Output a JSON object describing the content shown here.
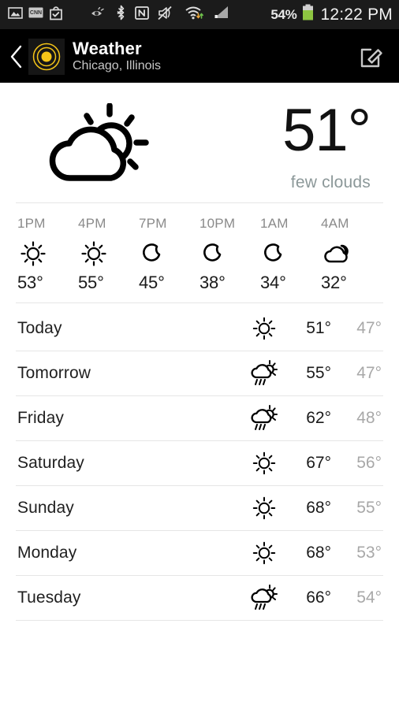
{
  "status_bar": {
    "icons": [
      {
        "name": "gallery-icon"
      },
      {
        "name": "cnn-news-icon",
        "label": "CNN"
      },
      {
        "name": "play-store-icon"
      },
      {
        "name": "smart-stay-eye-icon"
      },
      {
        "name": "bluetooth-icon"
      },
      {
        "name": "nfc-icon",
        "label": "N"
      },
      {
        "name": "sound-mute-icon"
      },
      {
        "name": "wifi-icon"
      },
      {
        "name": "cellular-signal-icon"
      }
    ],
    "battery_percent": "54%",
    "battery_color": "#8ec641",
    "clock": "12:22 PM"
  },
  "app_bar": {
    "back_icon": "back-chevron-icon",
    "app_icon": "weather-target-icon",
    "app_icon_color": "#f5c518",
    "title": "Weather",
    "subtitle": "Chicago, Illinois",
    "edit_icon": "edit-compose-icon"
  },
  "current": {
    "condition_icon": "partly-cloudy-day-icon",
    "temperature": "51°",
    "description": "few clouds"
  },
  "hourly": {
    "items": [
      {
        "time": "1PM",
        "icon": "sun-icon",
        "temp": "53°"
      },
      {
        "time": "4PM",
        "icon": "sun-icon",
        "temp": "55°"
      },
      {
        "time": "7PM",
        "icon": "moon-icon",
        "temp": "45°"
      },
      {
        "time": "10PM",
        "icon": "moon-icon",
        "temp": "38°"
      },
      {
        "time": "1AM",
        "icon": "moon-icon",
        "temp": "34°"
      },
      {
        "time": "4AM",
        "icon": "cloud-night-icon",
        "temp": "32°"
      }
    ]
  },
  "daily": {
    "items": [
      {
        "day": "Today",
        "icon": "sun-icon",
        "high": "51°",
        "low": "47°"
      },
      {
        "day": "Tomorrow",
        "icon": "sun-shower-icon",
        "high": "55°",
        "low": "47°"
      },
      {
        "day": "Friday",
        "icon": "sun-shower-icon",
        "high": "62°",
        "low": "48°"
      },
      {
        "day": "Saturday",
        "icon": "sun-icon",
        "high": "67°",
        "low": "56°"
      },
      {
        "day": "Sunday",
        "icon": "sun-icon",
        "high": "68°",
        "low": "55°"
      },
      {
        "day": "Monday",
        "icon": "sun-icon",
        "high": "68°",
        "low": "53°"
      },
      {
        "day": "Tuesday",
        "icon": "sun-shower-icon",
        "high": "66°",
        "low": "54°"
      }
    ]
  }
}
